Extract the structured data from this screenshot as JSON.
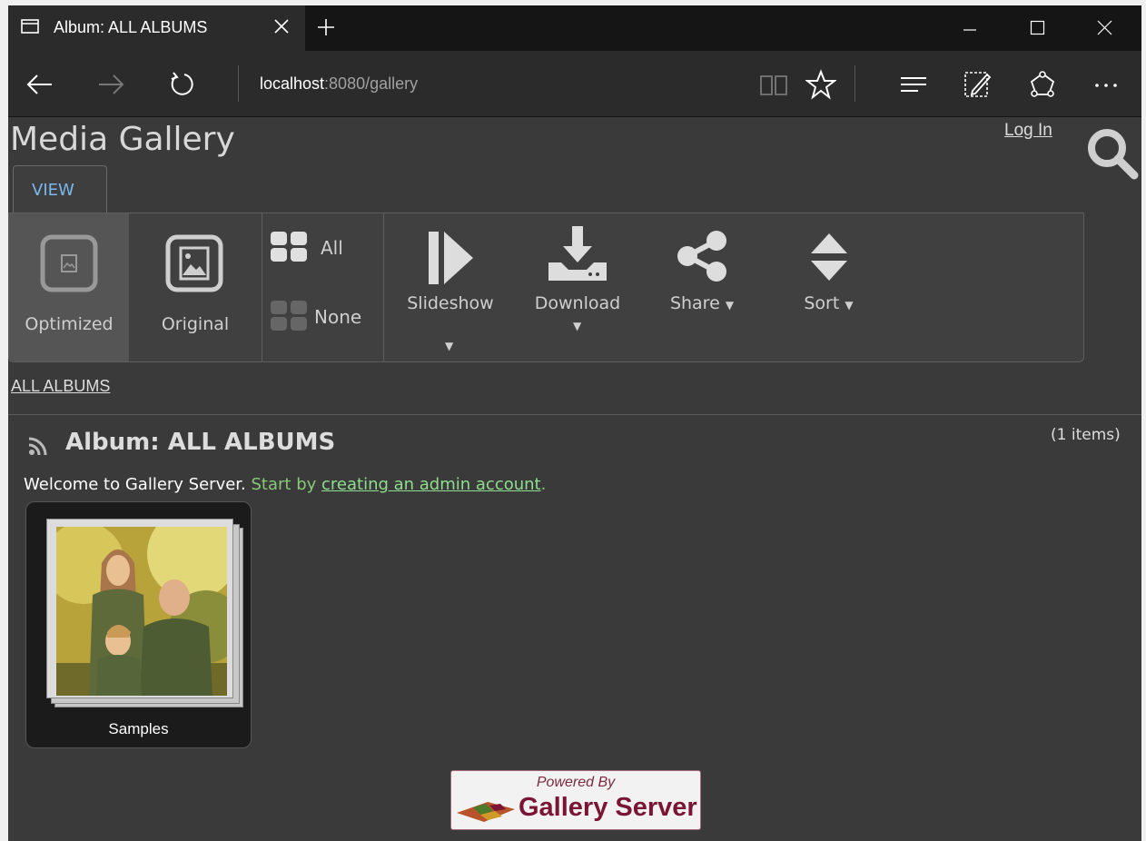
{
  "browser": {
    "tab_title": "Album: ALL ALBUMS",
    "url_host": "localhost",
    "url_rest": ":8080/gallery"
  },
  "site": {
    "title": "Media Gallery",
    "login": "Log In"
  },
  "ribbon": {
    "tab": "VIEW",
    "optimized": "Optimized",
    "original": "Original",
    "select_all": "All",
    "select_none": "None",
    "slideshow": "Slideshow",
    "download": "Download",
    "share": "Share",
    "sort": "Sort"
  },
  "breadcrumb": "ALL ALBUMS",
  "album": {
    "title": "Album: ALL ALBUMS",
    "count": "(1 items)",
    "welcome_prefix": "Welcome to Gallery Server. ",
    "welcome_green": "Start by ",
    "welcome_link": "creating an admin account",
    "welcome_suffix": ".",
    "thumb_label": "Samples"
  },
  "footer": {
    "powered_by": "Powered By",
    "brand": "Gallery Server"
  },
  "colors": {
    "page_bg": "#3a3a3a",
    "tab_accent": "#7ab8ee",
    "link_green": "#8fdd8f"
  }
}
